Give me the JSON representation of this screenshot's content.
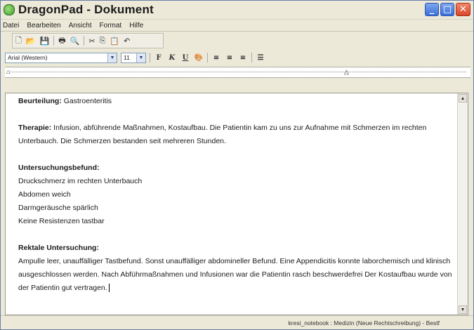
{
  "window": {
    "title": "DragonPad - Dokument"
  },
  "menu": [
    "Datei",
    "Bearbeiten",
    "Ansicht",
    "Format",
    "Hilfe"
  ],
  "formatbar": {
    "font": "Arial (Western)",
    "size": "11",
    "bold": "F",
    "italic": "K",
    "underline": "U"
  },
  "document": {
    "beurteilung_label": "Beurteilung:",
    "beurteilung_text": " Gastroenteritis",
    "therapie_label": "Therapie:",
    "therapie_text": " Infusion, abführende Maßnahmen, Kostaufbau. Die Patientin kam zu uns zur Aufnahme mit Schmerzen im rechten Unterbauch. Die Schmerzen bestanden seit mehreren Stunden.",
    "befund_label": "Untersuchungsbefund:",
    "befund_lines": [
      "Druckschmerz im rechten Unterbauch",
      "Abdomen weich",
      "Darmgeräusche spärlich",
      "Keine Resistenzen tastbar"
    ],
    "rektal_label": "Rektale Untersuchung:",
    "rektal_text": "Ampulle leer, unauffälliger Tastbefund. Sonst unauffälliger abdomineller Befund. Eine Appendicitis konnte laborchemisch und klinisch ausgeschlossen werden. Nach Abführmaßnahmen und Infusionen war die Patientin rasch beschwerdefrei  Der Kostaufbau wurde von der Patientin gut vertragen."
  },
  "status": {
    "text": "kresi_notebook : Medizin (Neue Rechtschreibung) - Bestf"
  }
}
